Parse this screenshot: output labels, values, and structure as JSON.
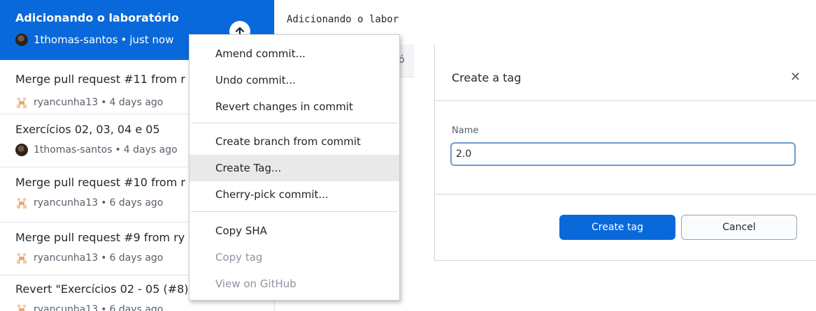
{
  "header": {
    "diff_title": "Adicionando o labor",
    "partial_text": "ó"
  },
  "commits": [
    {
      "title": "Adicionando o laboratório",
      "author": "1thomas-santos",
      "time": "just now",
      "avatar": "photo-avatar"
    },
    {
      "title": "Merge pull request #11 from r",
      "author": "ryancunha13",
      "time": "4 days ago",
      "avatar": "pixel-avatar"
    },
    {
      "title": "Exercícios 02, 03, 04 e 05",
      "author": "1thomas-santos",
      "time": "4 days ago",
      "avatar": "photo-avatar"
    },
    {
      "title": "Merge pull request #10 from r",
      "author": "ryancunha13",
      "time": "6 days ago",
      "avatar": "pixel-avatar"
    },
    {
      "title": "Merge pull request #9 from ry",
      "author": "ryancunha13",
      "time": "6 days ago",
      "avatar": "pixel-avatar"
    },
    {
      "title": "Revert \"Exercícios 02 - 05 (#8)",
      "author": "ryancunha13",
      "time": "6 days ago",
      "avatar": "pixel-avatar"
    }
  ],
  "meta_separator": "•",
  "push_icon": "arrow-up-icon",
  "context_menu": {
    "items": [
      {
        "label": "Amend commit...",
        "enabled": true
      },
      {
        "label": "Undo commit...",
        "enabled": true
      },
      {
        "label": "Revert changes in commit",
        "enabled": true
      },
      {
        "label": "Create branch from commit",
        "enabled": true
      },
      {
        "label": "Create Tag...",
        "enabled": true,
        "highlighted": true
      },
      {
        "label": "Cherry-pick commit...",
        "enabled": true
      },
      {
        "label": "Copy SHA",
        "enabled": true
      },
      {
        "label": "Copy tag",
        "enabled": false
      },
      {
        "label": "View on GitHub",
        "enabled": false
      }
    ]
  },
  "dialog": {
    "title": "Create a tag",
    "close_icon": "close-icon",
    "name_label": "Name",
    "name_value": "2.0",
    "primary_button": "Create tag",
    "secondary_button": "Cancel"
  },
  "colors": {
    "accent": "#0969da",
    "selected_text": "#ffffff",
    "muted_text": "#57606a",
    "disabled_text": "#8c959f"
  }
}
